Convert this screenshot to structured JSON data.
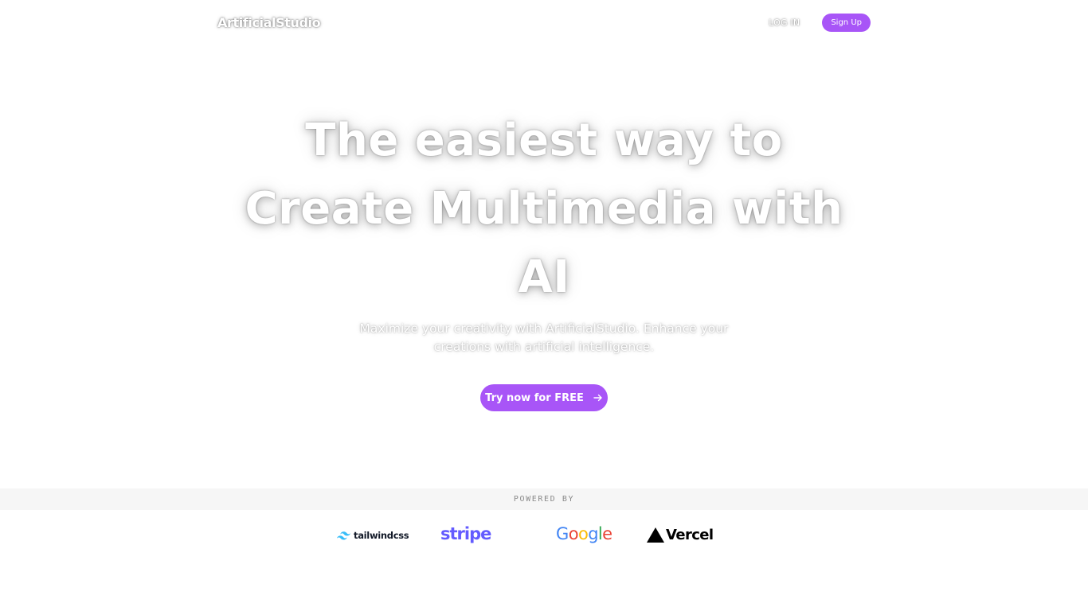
{
  "header": {
    "logo": "ArtificialStudio",
    "login_label": "LOG IN",
    "signup_label": "Sign Up"
  },
  "hero": {
    "title": "The easiest way to Create Multimedia with AI",
    "subtitle": "Maximize your creativity with ArtificialStudio. Enhance your creations with artificial intelligence.",
    "cta_label": "Try now for FREE",
    "cta_icon": "arrow-right-icon"
  },
  "powered_by": {
    "label": "POWERED BY",
    "partners": [
      {
        "name": "tailwindcss",
        "icon": "tailwind-logo-icon"
      },
      {
        "name": "stripe"
      },
      {
        "name": "Google"
      },
      {
        "name": "Vercel",
        "icon": "vercel-triangle-icon"
      }
    ]
  },
  "colors": {
    "accent": "#a855f7",
    "stripe": "#635bff",
    "google_blue": "#4285f4",
    "google_red": "#ea4335",
    "google_yellow": "#fbbc05",
    "google_green": "#34a853",
    "tailwind": "#38bdf8"
  }
}
